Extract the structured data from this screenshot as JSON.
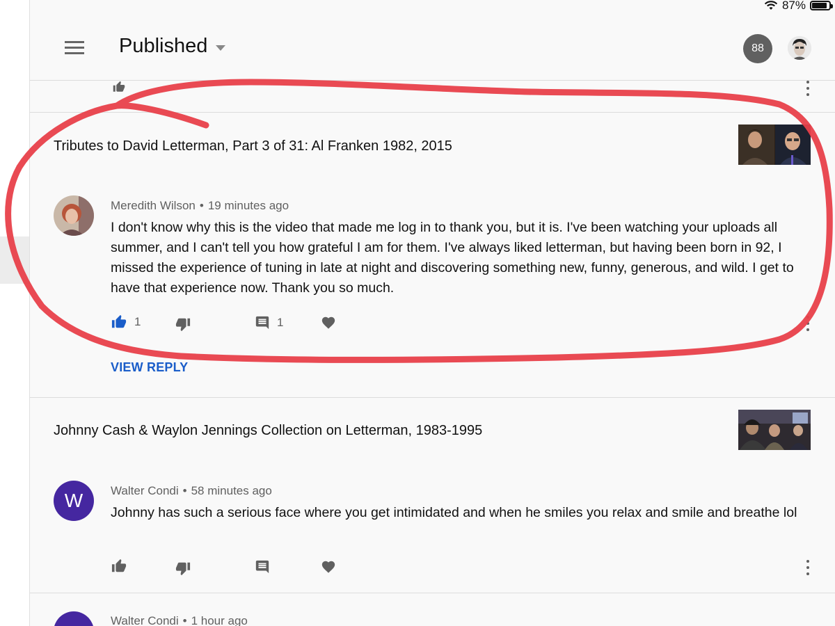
{
  "status_bar": {
    "battery_text": "87%",
    "battery_level": 0.87
  },
  "header": {
    "title": "Published",
    "notification_count": "88"
  },
  "comments": [
    {
      "video_title": "Tributes to David Letterman, Part 3 of 31: Al Franken 1982, 2015",
      "author": "Meredith Wilson",
      "time": "19 minutes ago",
      "text": "I don't know why this is the video that made me log in to thank you, but it is. I've been watching your uploads all summer, and I can't tell you how grateful I am for them. I've always liked letterman, but having been born in 92, I missed the experience of tuning in late at night and discovering something new, funny, generous, and wild. I get to have that experience now. Thank you so much.",
      "likes": "1",
      "replies": "1",
      "liked": true,
      "view_reply": "VIEW REPLY"
    },
    {
      "video_title": "Johnny Cash & Waylon Jennings Collection on Letterman, 1983-1995",
      "author": "Walter Condi",
      "avatar_letter": "W",
      "time": "58 minutes ago",
      "text": "Johnny has such a serious face where you get intimidated and when he smiles you relax and smile and breathe lol"
    },
    {
      "author": "Walter Condi",
      "time": "1 hour ago"
    }
  ],
  "colors": {
    "liked_blue": "#1a5dc9",
    "annotation_red": "#e8404a",
    "avatar_purple": "#4527a0",
    "icon_gray": "#606060"
  },
  "icons": [
    "menu-icon",
    "dropdown-caret-icon",
    "wifi-icon",
    "battery-icon",
    "thumbs-up-icon",
    "thumbs-down-icon",
    "reply-icon",
    "heart-icon",
    "more-vert-icon"
  ]
}
